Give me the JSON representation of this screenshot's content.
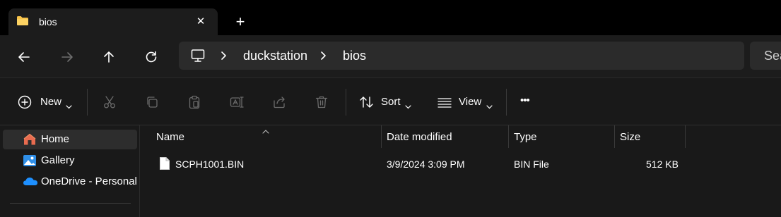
{
  "tab": {
    "title": "bios",
    "icon": "folder-icon",
    "close_glyph": "✕",
    "new_tab_glyph": "+"
  },
  "address": {
    "root_icon": "this-pc-icon",
    "crumbs": [
      "duckstation",
      "bios"
    ],
    "search_placeholder": "Search bios"
  },
  "toolbar": {
    "new_label": "New",
    "sort_label": "Sort",
    "view_label": "View",
    "more_glyph": "•••"
  },
  "sidebar": {
    "items": [
      {
        "label": "Home",
        "icon": "home-icon",
        "selected": true
      },
      {
        "label": "Gallery",
        "icon": "gallery-icon",
        "selected": false
      },
      {
        "label": "OneDrive - Personal",
        "icon": "onedrive-cloud-icon",
        "selected": false
      }
    ]
  },
  "filelist": {
    "columns": [
      "Name",
      "Date modified",
      "Type",
      "Size"
    ],
    "rows": [
      {
        "name": "SCPH1001.BIN",
        "modified": "3/9/2024 3:09 PM",
        "type": "BIN File",
        "size": "512 KB",
        "icon": "file-icon"
      }
    ]
  },
  "colors": {
    "window_bg": "#191919",
    "tabstrip_bg": "#000000",
    "addressbar_bg": "#2b2b2b",
    "folder_yellow": "#f8c34a",
    "onedrive_blue": "#1e90ff"
  }
}
